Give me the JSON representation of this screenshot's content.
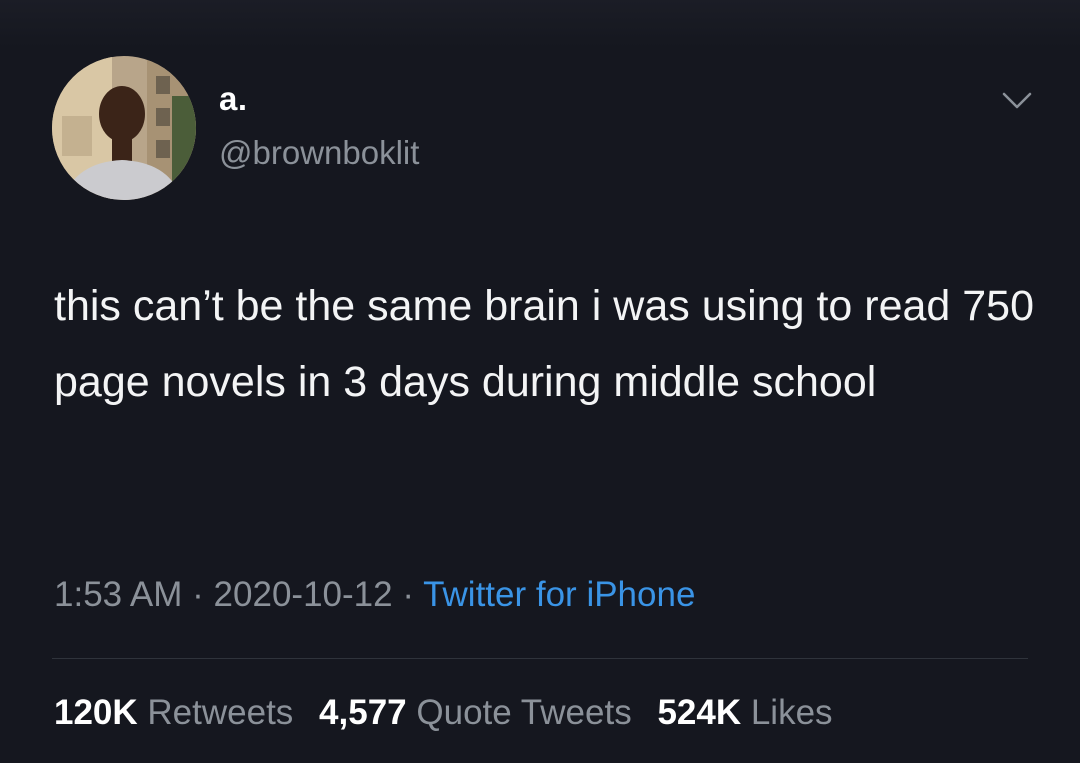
{
  "user": {
    "display_name": "a.",
    "handle": "@brownboklit"
  },
  "tweet": {
    "text": "this can’t be the same brain i was using to read 750 page novels in 3 days during middle school",
    "time": "1:53 AM",
    "separator": "·",
    "date": "2020-10-12",
    "source": "Twitter for iPhone"
  },
  "stats": {
    "retweets_count": "120K",
    "retweets_label": "Retweets",
    "quotes_count": "4,577",
    "quotes_label": "Quote Tweets",
    "likes_count": "524K",
    "likes_label": "Likes"
  },
  "icons": {
    "menu": "chevron-down-icon"
  },
  "colors": {
    "background": "#15171f",
    "text": "#f3f4f5",
    "secondary": "#8b9199",
    "link": "#3a94e6"
  }
}
